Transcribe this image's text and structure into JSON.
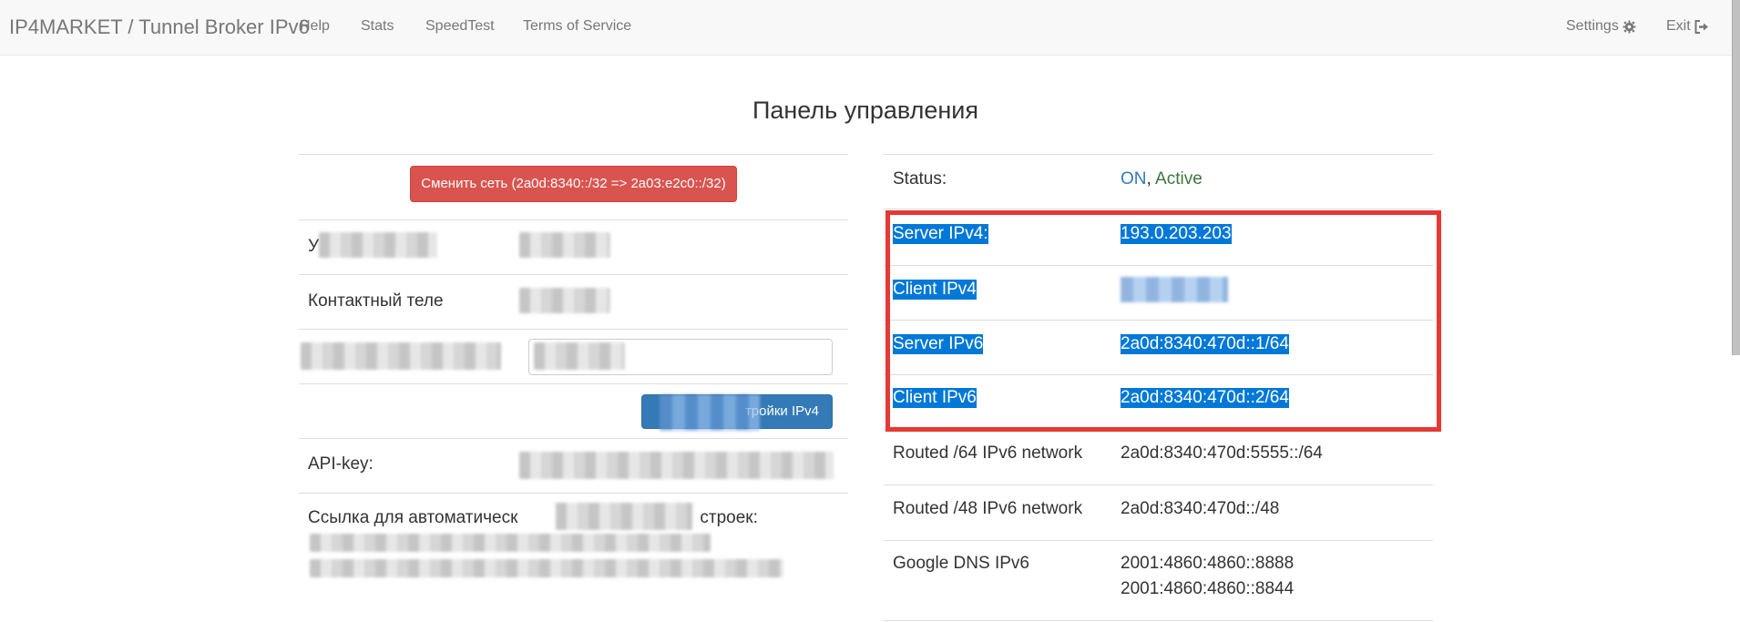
{
  "navbar": {
    "brand": "IP4MARKET / Tunnel Broker IPv6",
    "links": [
      "Help",
      "Stats",
      "SpeedTest",
      "Terms of Service"
    ],
    "settings_label": "Settings",
    "exit_label": "Exit"
  },
  "page": {
    "title": "Панель управления"
  },
  "left": {
    "change_network_button": "Сменить сеть (2a0d:8340::/32 => 2a03:e2c0::/32)",
    "row_user_label": "У",
    "row_phone_label": "Контактный теле",
    "save_ipv4_button": "тройки IPv4",
    "api_key_label": "API-key:",
    "auto_link_label_start": "Ссылка для автоматическ",
    "auto_link_label_end": "строек:"
  },
  "right": {
    "status_label": "Status:",
    "status_on": "ON",
    "status_sep": ",",
    "status_active": "Active",
    "server_ipv4_label": "Server IPv4:",
    "server_ipv4_value": "193.0.203.203",
    "client_ipv4_label": "Client IPv4",
    "server_ipv6_label": "Server IPv6",
    "server_ipv6_value": "2a0d:8340:470d::1/64",
    "client_ipv6_label": "Client IPv6",
    "client_ipv6_value": "2a0d:8340:470d::2/64",
    "routed64_label": "Routed /64 IPv6 network",
    "routed64_value": "2a0d:8340:470d:5555::/64",
    "routed48_label": "Routed /48 IPv6 network",
    "routed48_value": "2a0d:8340:470d::/48",
    "google_dns_label": "Google DNS IPv6",
    "google_dns_value1": "2001:4860:4860::8888",
    "google_dns_value2": "2001:4860:4860::8844"
  },
  "colors": {
    "danger": "#d9534f",
    "primary": "#337ab7",
    "highlight": "#0078d7",
    "annotation_box": "#e53935",
    "status_on": "#337ab7",
    "status_active": "#3c763d"
  }
}
